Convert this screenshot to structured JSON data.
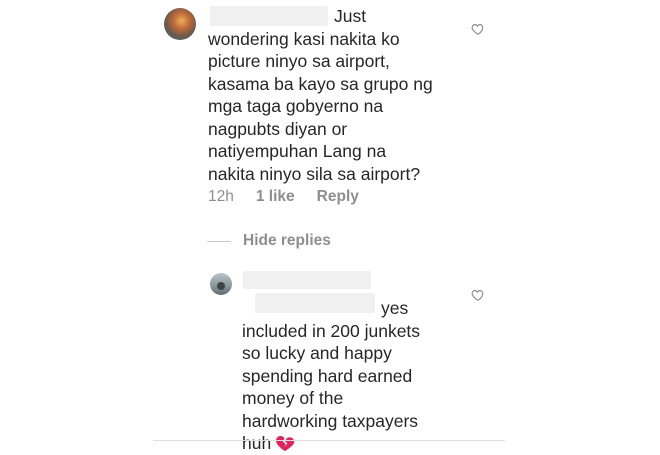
{
  "comments": [
    {
      "username": "",
      "lines": [
        "Just",
        "wondering kasi nakita ko",
        "picture ninyo sa airport,",
        "kasama ba kayo sa grupo ng",
        "mga taga gobyerno na",
        "nagpubts diyan or",
        "natiyempuhan Lang na",
        "nakita ninyo sila sa airport?"
      ],
      "time": "12h",
      "likes": "1 like",
      "reply_label": "Reply"
    }
  ],
  "hide_replies_label": "Hide replies",
  "replies": [
    {
      "username": "",
      "mention": "",
      "lines": [
        "yes",
        "included in 200 junkets",
        "so lucky and happy",
        "spending hard earned",
        "money of the",
        "hardworking taxpayers",
        "huh"
      ],
      "emoji": "broken-heart-icon"
    }
  ],
  "colors": {
    "text": "#262626",
    "meta": "#8e8e8e",
    "broken_heart": "#e0245e"
  }
}
